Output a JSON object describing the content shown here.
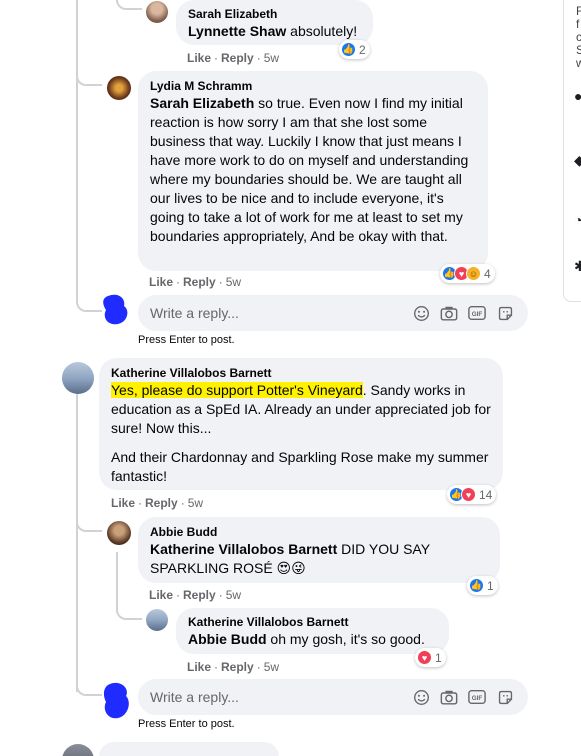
{
  "comments": {
    "sarah": {
      "author": "Sarah Elizabeth",
      "mention": "Lynnette Shaw",
      "text": " absolutely!",
      "like": "Like",
      "reply": "Reply",
      "time": "5w",
      "reaction_count": "2"
    },
    "lydia": {
      "author": "Lydia M Schramm",
      "mention": "Sarah Elizabeth",
      "text": " so true. Even now I find my initial reaction is how sorry I am that she lost some business that way. Luckily I know that just means I have more work to do on myself and understanding where my boundaries should be. We are taught all our lives to be nice and to include everyone, it's going to take a lot of work for me at least to set my boundaries appropriately, And be okay with that.",
      "like": "Like",
      "reply": "Reply",
      "time": "5w",
      "reaction_count": "4"
    },
    "katherine": {
      "author": "Katherine Villalobos Barnett",
      "highlight": "Yes, please do support Potter's Vineyard",
      "text": ". Sandy works in education as a SpEd IA. Already an under appreciated job for sure! Now this...",
      "para2": "And their Chardonnay and Sparkling Rose make my summer fantastic!",
      "like": "Like",
      "reply": "Reply",
      "time": "5w",
      "reaction_count": "14"
    },
    "abbie": {
      "author": "Abbie Budd",
      "mention": "Katherine Villalobos Barnett",
      "text": " DID YOU SAY SPARKLING ROSÉ 😍😜",
      "like": "Like",
      "reply": "Reply",
      "time": "5w",
      "reaction_count": "1"
    },
    "katherine2": {
      "author": "Katherine Villalobos Barnett",
      "mention": "Abbie Budd",
      "text": " oh my gosh, it's so good.",
      "like": "Like",
      "reply": "Reply",
      "time": "5w",
      "reaction_count": "1"
    }
  },
  "reply_boxes": {
    "placeholder": "Write a reply...",
    "hint": "Press Enter to post."
  },
  "sidebar_fragments": {
    "line1": "F",
    "line2": "f",
    "line3": "c",
    "line4": "S",
    "line5": "w"
  },
  "icons": [
    "emoji-icon",
    "camera-icon",
    "gif-icon",
    "sticker-icon",
    "like-reaction-icon",
    "love-reaction-icon",
    "care-reaction-icon"
  ],
  "colors": {
    "like": "#1877f2",
    "love": "#f33e58",
    "care": "#f7b125",
    "bubble": "#f0f2f5",
    "highlight": "#fff200"
  }
}
